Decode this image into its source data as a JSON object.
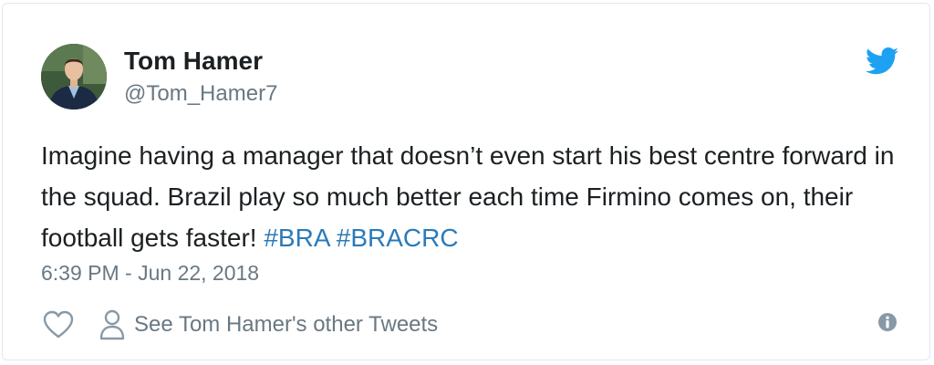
{
  "author": {
    "name": "Tom Hamer",
    "handle": "@Tom_Hamer7"
  },
  "tweet": {
    "text": "Imagine having a manager that doesn’t even start his best centre forward in the squad. Brazil play so much better each time Firmino comes on, their football gets faster! ",
    "hashtags": [
      "#BRA",
      "#BRACRC"
    ],
    "timestamp": "6:39 PM - Jun 22, 2018"
  },
  "actions": {
    "other_tweets_label": "See Tom Hamer's other Tweets"
  },
  "icons": {
    "logo": "twitter-bird-icon",
    "like": "heart-icon",
    "profile": "person-icon",
    "info": "info-icon"
  },
  "colors": {
    "brand_blue": "#1da1f2",
    "hashtag": "#2b7bb9",
    "secondary_text": "#697882",
    "primary_text": "#1c2022"
  }
}
